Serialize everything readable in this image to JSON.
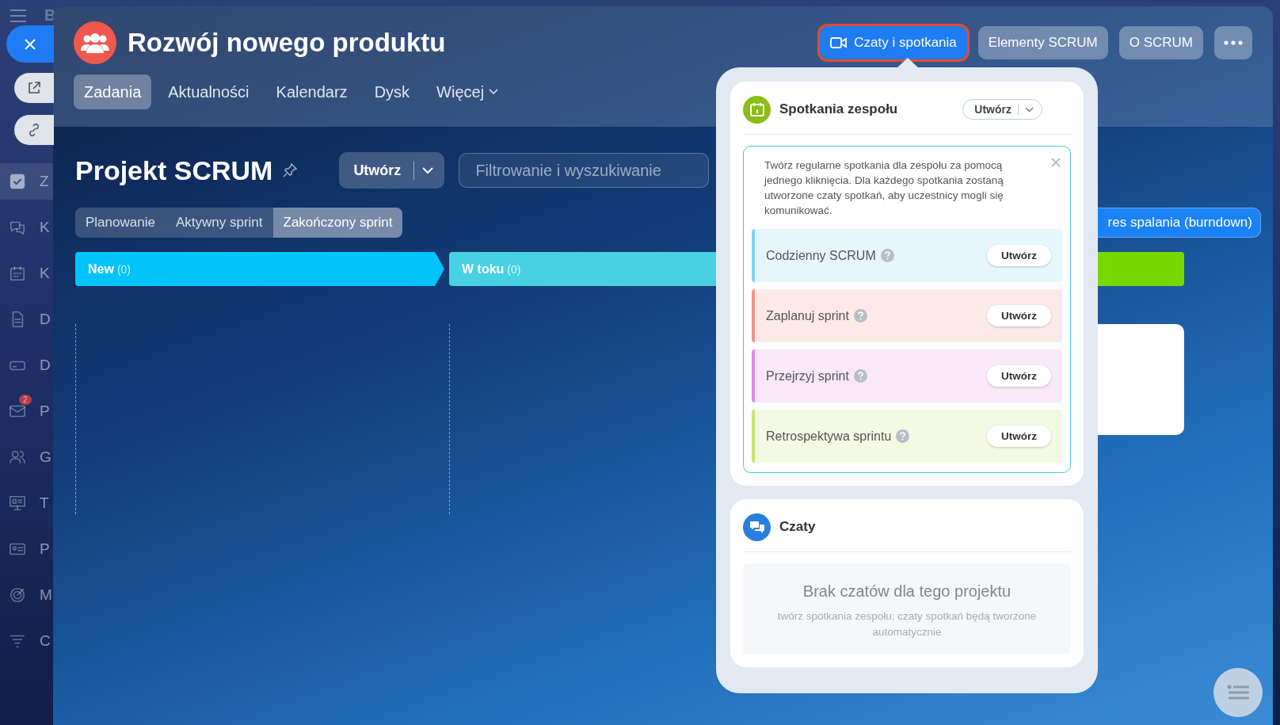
{
  "sidebar": {
    "logo": "B",
    "items": [
      {
        "label": "Z",
        "selected": true
      },
      {
        "label": "K",
        "selected": false
      },
      {
        "label": "K",
        "selected": false
      },
      {
        "label": "D",
        "selected": false
      },
      {
        "label": "D",
        "selected": false
      },
      {
        "label": "P",
        "selected": false,
        "badge": "2"
      },
      {
        "label": "G",
        "selected": false
      },
      {
        "label": "T",
        "selected": false
      },
      {
        "label": "P",
        "selected": false
      },
      {
        "label": "M",
        "selected": false
      },
      {
        "label": "C",
        "selected": false
      }
    ]
  },
  "header": {
    "title": "Rozwój nowego produktu",
    "nav": [
      {
        "label": "Zadania",
        "selected": true,
        "dropdown": false
      },
      {
        "label": "Aktualności",
        "selected": false,
        "dropdown": false
      },
      {
        "label": "Kalendarz",
        "selected": false,
        "dropdown": false
      },
      {
        "label": "Dysk",
        "selected": false,
        "dropdown": false
      },
      {
        "label": "Więcej",
        "selected": false,
        "dropdown": true
      }
    ],
    "actions": [
      {
        "label": "Czaty i spotkania",
        "selected": true,
        "kind": "video"
      },
      {
        "label": "Elementy SCRUM",
        "selected": false,
        "kind": "plain"
      },
      {
        "label": "O SCRUM",
        "selected": false,
        "kind": "plain"
      }
    ]
  },
  "toolbar": {
    "title": "Projekt SCRUM",
    "create": "Utwórz",
    "search": {
      "placeholder": "Filtrowanie i wyszukiwanie"
    }
  },
  "sprint_tabs": [
    {
      "label": "Planowanie",
      "selected": false
    },
    {
      "label": "Aktywny sprint",
      "selected": false
    },
    {
      "label": "Zakończony sprint",
      "selected": true
    }
  ],
  "burndown_button": "res spalania (burndown)",
  "columns": [
    {
      "name": "New",
      "count": "(0)",
      "color": "#00c3fa"
    },
    {
      "name": "W toku",
      "count": "(0)",
      "color": "#47d1e2"
    },
    {
      "color": "#75d900"
    }
  ],
  "popup": {
    "meetings": {
      "title": "Spotkania zespołu",
      "create": "Utwórz",
      "hint": "Twórz regularne spotkania dla zespołu za pomocą jednego kliknięcia. Dla każdego spotkania zostaną utworzone czaty spotkań, aby uczestnicy mogli się komunikować.",
      "items": [
        {
          "name": "Codzienny SCRUM",
          "button": "Utwórz",
          "color": "#7fd4f0"
        },
        {
          "name": "Zaplanuj sprint",
          "button": "Utwórz",
          "color": "#f4958b"
        },
        {
          "name": "Przejrzyj sprint",
          "button": "Utwórz",
          "color": "#df8ee6"
        },
        {
          "name": "Retrospektywa sprintu",
          "button": "Utwórz",
          "color": "#c8e36e"
        }
      ]
    },
    "chats": {
      "title": "Czaty",
      "empty_title": "Brak czatów dla tego projektu",
      "empty_text": "twórz spotkania zespołu; czaty spotkań będą tworzone automatycznie"
    }
  }
}
